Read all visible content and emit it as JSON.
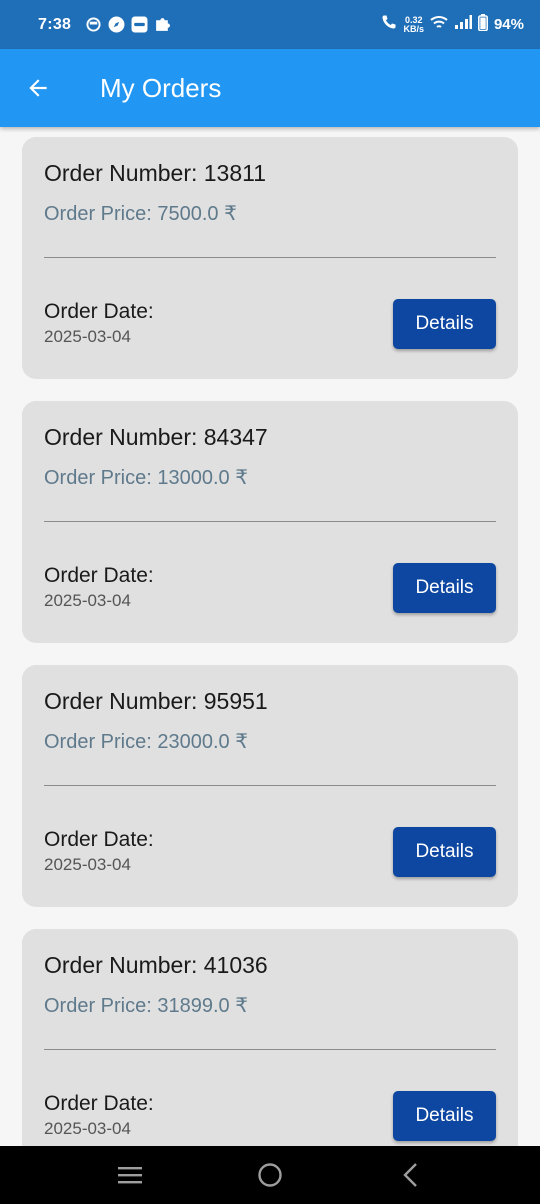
{
  "status_bar": {
    "time": "7:38",
    "speed_value": "0.32",
    "speed_unit": "KB/s",
    "battery": "94%",
    "icons": [
      "app-icon",
      "compass-icon",
      "vivo-icon",
      "puzzle-icon",
      "call-icon",
      "wifi-icon",
      "signal-icon",
      "battery-icon"
    ]
  },
  "app_bar": {
    "title": "My Orders",
    "background": "#2196f3"
  },
  "orders": [
    {
      "number": "Order Number: 13811",
      "price": "Order Price: 7500.0 ₹",
      "date_label": "Order Date:",
      "date": "2025-03-04",
      "button": "Details"
    },
    {
      "number": "Order Number: 84347",
      "price": "Order Price: 13000.0 ₹",
      "date_label": "Order Date:",
      "date": "2025-03-04",
      "button": "Details"
    },
    {
      "number": "Order Number: 95951",
      "price": "Order Price: 23000.0 ₹",
      "date_label": "Order Date:",
      "date": "2025-03-04",
      "button": "Details"
    },
    {
      "number": "Order Number: 41036",
      "price": "Order Price: 31899.0 ₹",
      "date_label": "Order Date:",
      "date": "2025-03-04",
      "button": "Details"
    }
  ],
  "colors": {
    "accent": "#2196f3",
    "button": "#0d47a1",
    "card": "#e0e0e0",
    "price_text": "#5f7a8c"
  }
}
